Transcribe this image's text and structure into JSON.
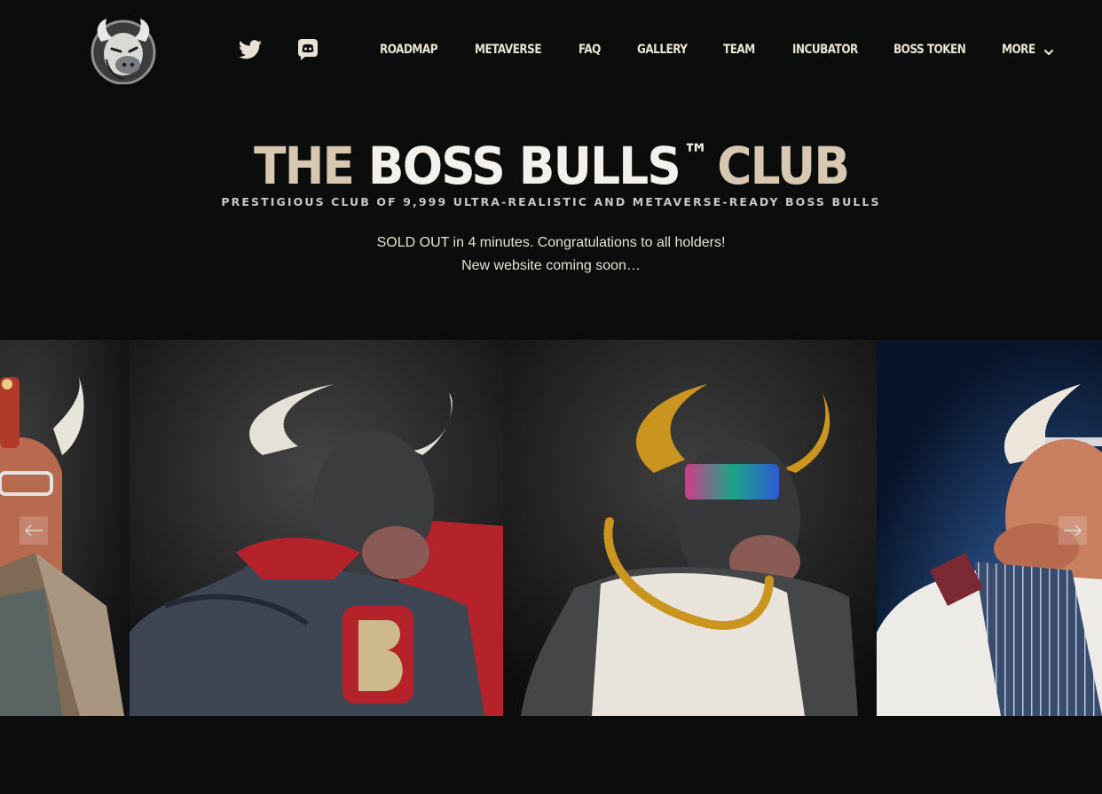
{
  "header": {
    "logo_icon": "bull-head-logo-icon",
    "social": [
      {
        "name": "twitter",
        "icon": "twitter-bird-icon"
      },
      {
        "name": "discord",
        "icon": "discord-icon"
      }
    ],
    "nav": [
      "ROADMAP",
      "METAVERSE",
      "FAQ",
      "GALLERY",
      "TEAM",
      "INCUBATOR",
      "BOSS TOKEN",
      "MORE"
    ],
    "more_icon": "chevron-down-icon"
  },
  "hero": {
    "title_part1": "THE",
    "title_part2": "BOSS BULLS",
    "title_tm": "™",
    "title_part3": "CLUB",
    "subtitle": "PRESTIGIOUS CLUB OF 9,999 ULTRA-REALISTIC AND METAVERSE-READY BOSS BULLS",
    "line1": "SOLD OUT in 4 minutes. Congratulations to all holders!",
    "line2": "New website coming soon…"
  },
  "carousel": {
    "prev_icon": "arrow-left-icon",
    "next_icon": "arrow-right-icon",
    "slides": [
      {
        "subject": "bull-professor-crown-glasses"
      },
      {
        "subject": "bull-superhero-suit"
      },
      {
        "subject": "bull-tank-top-gold-chain"
      },
      {
        "subject": "bull-pinstripe-suit-tiara"
      }
    ]
  },
  "colors": {
    "background": "#0b0d0d",
    "title_beige": "#d8c8b2",
    "title_white": "#f4f1ec",
    "nav_text": "#e9e2d4"
  }
}
